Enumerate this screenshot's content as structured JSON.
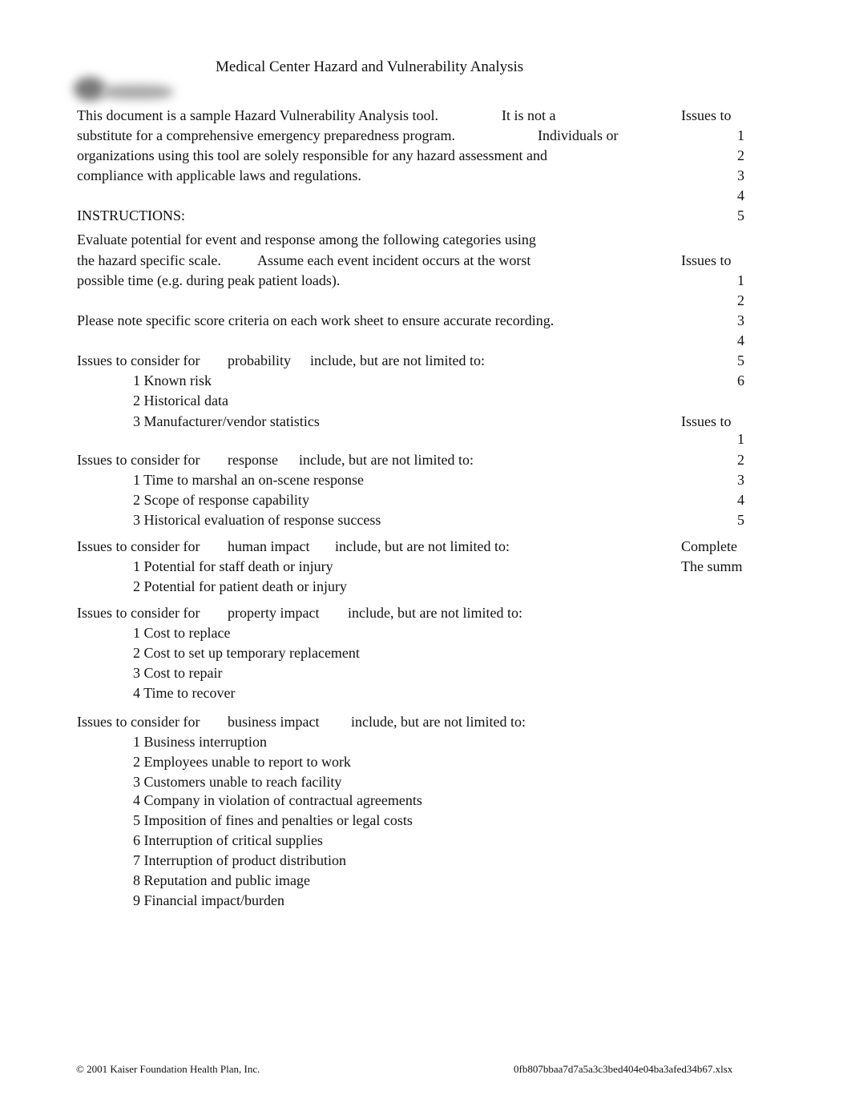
{
  "title": "Medical Center Hazard and Vulnerability Analysis",
  "logo": {
    "icon": "organization-logo-blurred"
  },
  "intro": {
    "line1a": "This document is a sample Hazard Vulnerability Analysis tool.",
    "line1b": "It is not a",
    "line2a": "substitute for a comprehensive emergency preparedness program.",
    "line2b": "Individuals or",
    "line3": "organizations using this tool are solely responsible for any hazard assessment and",
    "line4": "compliance with applicable laws and regulations."
  },
  "instructions": {
    "heading": "INSTRUCTIONS:",
    "line1": "Evaluate potential for event and response among the following categories using",
    "line2a": "the hazard specific scale.",
    "line2b": "Assume each event incident occurs at the worst",
    "line3": "possible time (e.g. during peak patient loads).",
    "note": "Please note specific score criteria on each work sheet to ensure accurate recording."
  },
  "categories": [
    {
      "prefix": "Issues to consider for",
      "name": "probability",
      "suffix": "include, but are not limited to:",
      "items": [
        "1 Known risk",
        "2 Historical data",
        "3 Manufacturer/vendor statistics"
      ]
    },
    {
      "prefix": "Issues to consider for",
      "name": "response",
      "suffix": "include, but are not limited to:",
      "items": [
        "1 Time to marshal an on-scene response",
        "2 Scope of response capability",
        "3 Historical evaluation of response success"
      ]
    },
    {
      "prefix": "Issues to consider for",
      "name": "human impact",
      "suffix": "include, but are not limited to:",
      "items": [
        "1 Potential for staff death or injury",
        "2 Potential for patient death or injury"
      ]
    },
    {
      "prefix": "Issues to consider for",
      "name": "property impact",
      "suffix": "include, but are not limited to:",
      "items": [
        "1 Cost to replace",
        "2 Cost to set up temporary replacement",
        "3 Cost to repair",
        "4 Time to recover"
      ]
    },
    {
      "prefix": "Issues to consider for",
      "name": "business impact",
      "suffix": "include, but are not limited to:",
      "items": [
        "1 Business interruption",
        "2 Employees unable to report to work",
        "3 Customers unable to reach facility",
        "4 Company in violation of contractual agreements",
        "5 Imposition of fines and penalties or legal costs",
        "6 Interruption of critical supplies",
        "7 Interruption of product distribution",
        "8 Reputation and public image",
        "9 Financial impact/burden"
      ]
    }
  ],
  "right_column": {
    "group1": {
      "heading": "Issues to",
      "numbers": [
        "1",
        "2",
        "3",
        "4",
        "5"
      ]
    },
    "group2": {
      "heading": "Issues to",
      "numbers": [
        "1",
        "2",
        "3",
        "4",
        "5",
        "6"
      ]
    },
    "group3": {
      "heading": "Issues to",
      "numbers": [
        "1",
        "2",
        "3",
        "4",
        "5"
      ]
    },
    "complete": "Complete",
    "summ": "The summ"
  },
  "footer": {
    "copyright": "© 2001 Kaiser Foundation Health Plan, Inc.",
    "filename": "0fb807bbaa7d7a5a3c3bed404e04ba3afed34b67.xlsx"
  }
}
